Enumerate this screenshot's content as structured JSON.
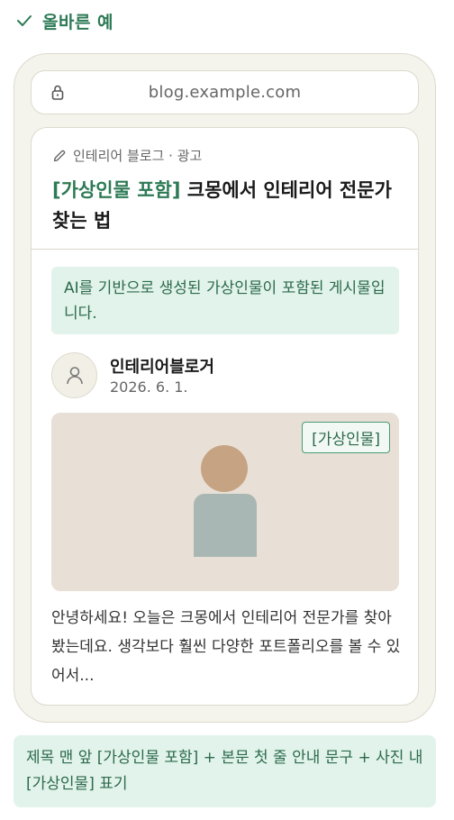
{
  "heading": {
    "text": "올바른 예"
  },
  "browser": {
    "url": "blog.example.com"
  },
  "post": {
    "category": "인테리어 블로그 · 광고",
    "title_tag": "[가상인물 포함]",
    "title_rest": " 크몽에서 인테리어 전문가 찾는 법",
    "notice": "AI를 기반으로 생성된 가상인물이 포함된 게시물입니다.",
    "author": "인테리어블로거",
    "date": "2026. 6. 1.",
    "photo_badge": "[가상인물]",
    "excerpt": "안녕하세요! 오늘은 크몽에서 인테리어 전문가를 찾아봤는데요. 생각보다 훨씬 다양한 포트폴리오를 볼 수 있어서..."
  },
  "footnote": "제목 맨 앞 [가상인물 포함] + 본문 첫 줄 안내 문구 + 사진 내 [가상인물] 표기",
  "colors": {
    "accent": "#2d7a55",
    "notice_bg": "#e1f3ea",
    "phone_bg": "#f4f3ec",
    "photo_bg": "#e8e0d6"
  },
  "icons": [
    "check-icon",
    "lock-icon",
    "pencil-icon",
    "user-icon"
  ]
}
